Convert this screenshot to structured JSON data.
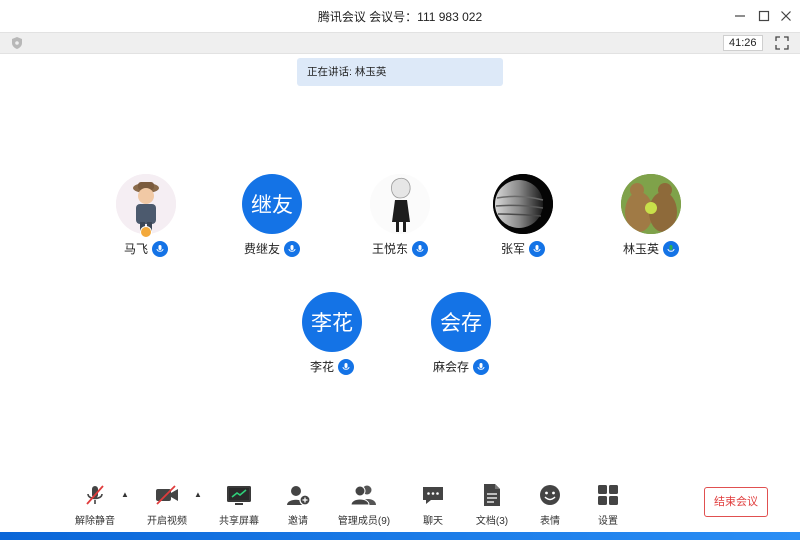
{
  "window": {
    "title": "腾讯会议 会议号：111 983 022",
    "timer": "41:26"
  },
  "speaking_banner": "正在讲话: 林玉英",
  "participants": [
    {
      "name": "马飞",
      "avatar": "photo-child",
      "mic": "on"
    },
    {
      "name": "费继友",
      "avatar_text": "继友",
      "mic": "on"
    },
    {
      "name": "王悦东",
      "avatar": "photo-anime",
      "mic": "on"
    },
    {
      "name": "张军",
      "avatar": "photo-planet",
      "mic": "on"
    },
    {
      "name": "林玉英",
      "avatar": "photo-bears",
      "mic": "speaking"
    },
    {
      "name": "李花",
      "avatar_text": "李花",
      "mic": "on"
    },
    {
      "name": "麻会存",
      "avatar_text": "会存",
      "mic": "on"
    }
  ],
  "toolbar": {
    "unmute": "解除静音",
    "start_video": "开启视频",
    "share_screen": "共享屏幕",
    "invite": "邀请",
    "manage_members": "管理成员(9)",
    "chat": "聊天",
    "docs": "文档(3)",
    "reactions": "表情",
    "settings": "设置",
    "end_meeting": "结束会议"
  },
  "colors": {
    "accent": "#1473e6",
    "end": "#e03c3c",
    "speaking": "#2fb14f"
  }
}
